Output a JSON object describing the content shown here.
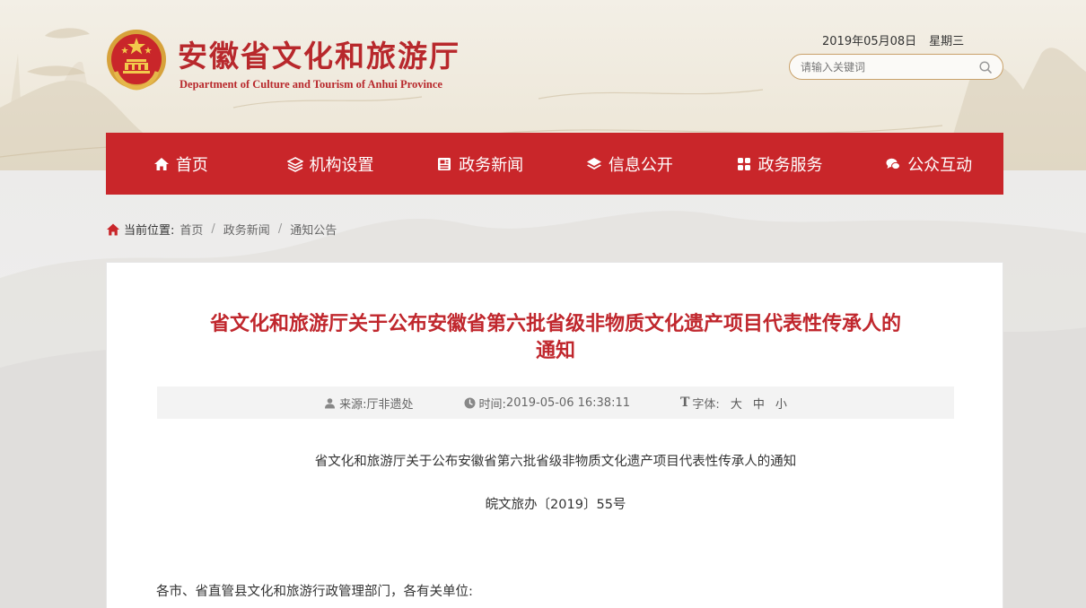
{
  "header": {
    "site_title": "安徽省文化和旅游厅",
    "site_subtitle": "Department of Culture and Tourism of Anhui Province",
    "date": "2019年05月08日",
    "weekday": "星期三",
    "search_placeholder": "请输入关键词"
  },
  "nav": {
    "items": [
      {
        "label": "首页",
        "icon": "home-icon"
      },
      {
        "label": "机构设置",
        "icon": "layers-icon"
      },
      {
        "label": "政务新闻",
        "icon": "newspaper-icon"
      },
      {
        "label": "信息公开",
        "icon": "stack-icon"
      },
      {
        "label": "政务服务",
        "icon": "grid-icon"
      },
      {
        "label": "公众互动",
        "icon": "chat-icon"
      }
    ]
  },
  "breadcrumb": {
    "label": "当前位置:",
    "items": [
      "首页",
      "政务新闻",
      "通知公告"
    ],
    "separator": "/"
  },
  "article": {
    "title_line1": "省文化和旅游厅关于公布安徽省第六批省级非物质文化遗产项目代表性传承人的",
    "title_line2": "通知",
    "source_label": "来源:",
    "source": "厅非遗处",
    "time_label": "时间:",
    "time": "2019-05-06 16:38:11",
    "font_label": "字体:",
    "font_sizes": [
      "大",
      "中",
      "小"
    ],
    "body_title": "省文化和旅游厅关于公布安徽省第六批省级非物质文化遗产项目代表性传承人的通知",
    "doc_number": "皖文旅办〔2019〕55号",
    "salutation": "各市、省直管县文化和旅游行政管理部门，各有关单位:"
  },
  "colors": {
    "brand_red": "#c9262a",
    "title_red": "#c0272d",
    "search_border": "#c9a16a"
  }
}
